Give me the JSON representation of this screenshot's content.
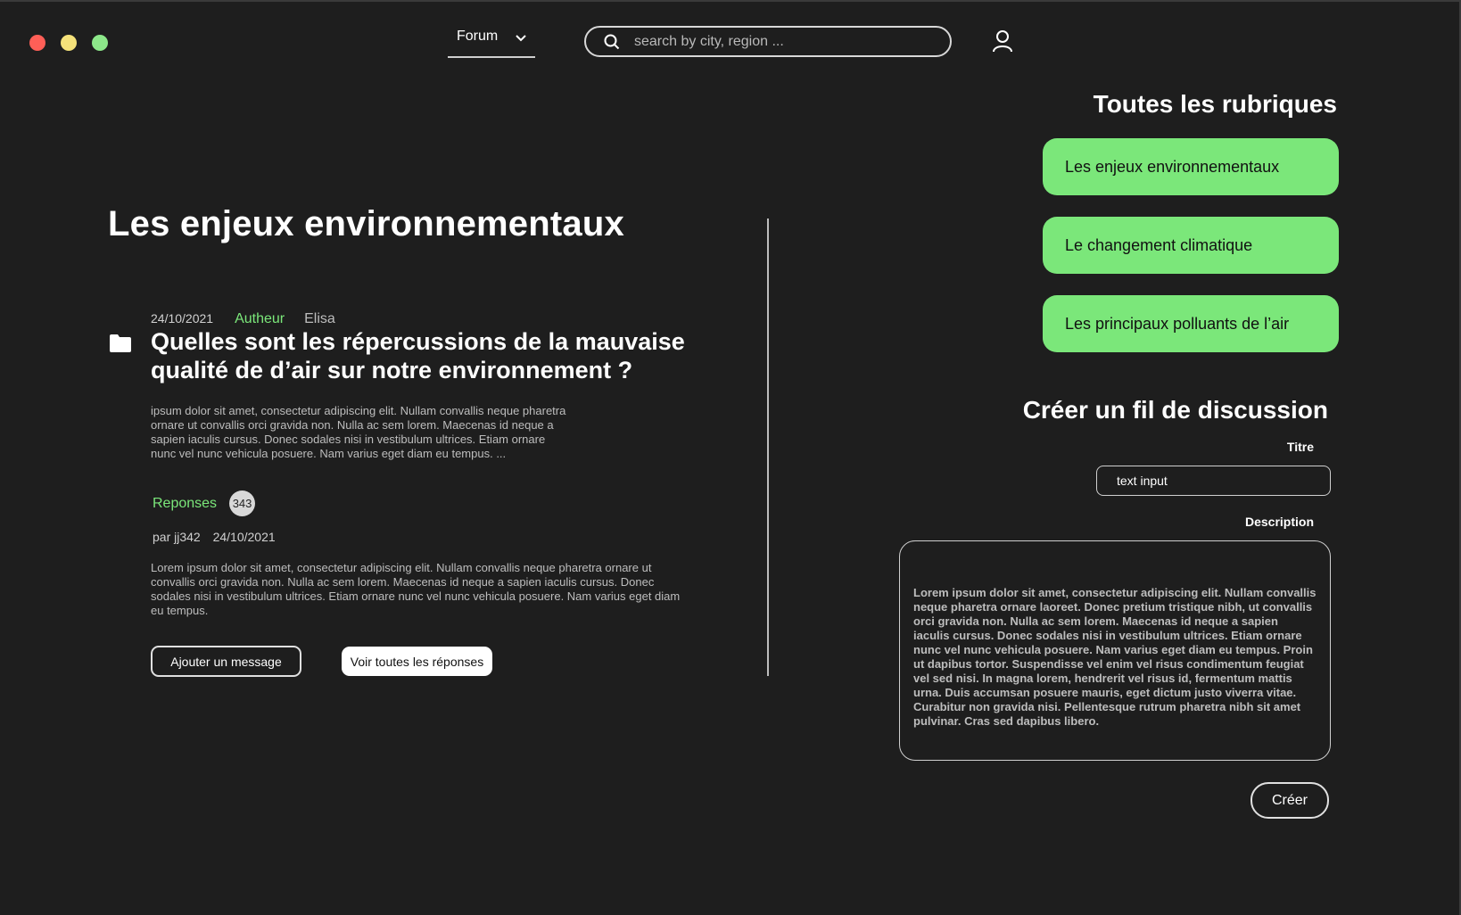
{
  "window": {
    "controls": [
      "close",
      "minimize",
      "maximize"
    ]
  },
  "header": {
    "nav_select": "Forum",
    "search_placeholder": "search by city, region ...",
    "icons": {
      "search": "search-icon",
      "user": "user-icon",
      "dropdown": "chevron-down-icon"
    }
  },
  "main": {
    "title": "Les enjeux environnementaux",
    "post": {
      "date": "24/10/2021",
      "author_label": "Autheur",
      "author": "Elisa",
      "title": "Quelles sont les répercussions de la mauvaise qualité de d’air sur notre environnement ?",
      "excerpt": "ipsum dolor sit amet, consectetur adipiscing elit. Nullam convallis neque pharetra ornare ut convallis orci gravida non. Nulla ac sem lorem. Maecenas id neque a sapien iaculis cursus. Donec sodales nisi in vestibulum ultrices. Etiam ornare nunc vel nunc vehicula posuere. Nam varius eget diam eu tempus.  ...",
      "replies_label": "Reponses",
      "replies_count": "343",
      "reply_author": "par jj342",
      "reply_date": "24/10/2021",
      "reply_text": "Lorem ipsum dolor sit amet, consectetur adipiscing elit. Nullam convallis neque pharetra ornare ut convallis orci gravida non. Nulla ac sem lorem. Maecenas id neque a sapien iaculis cursus. Donec sodales nisi in vestibulum ultrices. Etiam ornare nunc vel nunc vehicula posuere. Nam varius eget diam eu tempus.",
      "add_message_label": "Ajouter un message",
      "see_all_label": "Voir toutes les réponses"
    }
  },
  "sidebar": {
    "rubriques_title": "Toutes les rubriques",
    "rubriques": [
      {
        "label": "Les enjeux environnementaux"
      },
      {
        "label": "Le changement climatique"
      },
      {
        "label": "Les principaux polluants de l’air"
      }
    ],
    "create": {
      "title": "Créer un fil de discussion",
      "titre_label": "Titre",
      "titre_value": "text input",
      "description_label": "Description",
      "description_value": "Lorem ipsum dolor sit amet, consectetur adipiscing elit. Nullam convallis neque pharetra ornare laoreet. Donec pretium tristique nibh, ut convallis orci gravida non. Nulla ac sem lorem. Maecenas id neque a sapien iaculis cursus. Donec sodales nisi in vestibulum ultrices. Etiam ornare nunc vel nunc vehicula posuere. Nam varius eget diam eu tempus. Proin ut dapibus tortor. Suspendisse vel enim vel risus condimentum feugiat vel sed nisi. In magna lorem, hendrerit vel risus id, fermentum mattis urna. Duis accumsan posuere mauris, eget dictum justo viverra vitae. Curabitur non gravida nisi. Pellentesque rutrum pharetra nibh sit amet pulvinar. Cras sed dapibus libero.",
      "submit_label": "Créer"
    }
  },
  "colors": {
    "background": "#1e1e1e",
    "accent": "#7be77a",
    "text": "#ffffff",
    "muted": "#bdbdbd"
  }
}
